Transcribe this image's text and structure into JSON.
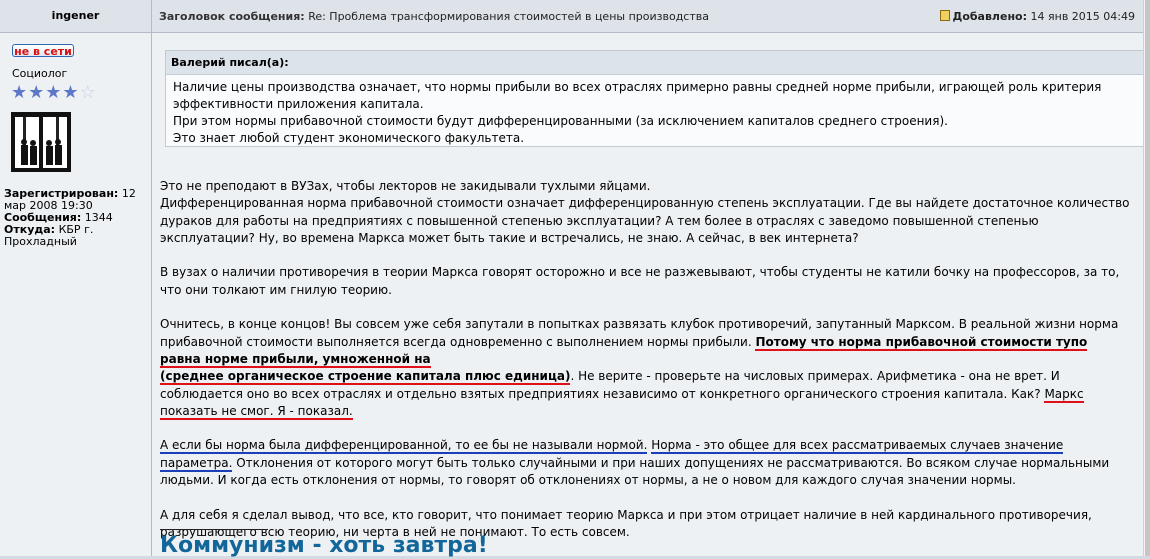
{
  "post": {
    "author": "ingener",
    "subject_label": "Заголовок сообщения:",
    "subject_text": "Re: Проблема трансформирования стоимостей в цены производства",
    "posted_label": "Добавлено:",
    "posted_date": "14 янв 2015 04:49"
  },
  "profile": {
    "status_button": "не в сети",
    "rank": "Социолог",
    "stars_filled": 4,
    "stars_total": 5,
    "registered_label": "Зарегистрирован:",
    "registered_value": "12 мар 2008 19:30",
    "posts_label": "Сообщения:",
    "posts_value": "1344",
    "location_label": "Откуда:",
    "location_value": "КБР г. Прохладный"
  },
  "quote": {
    "header": "Валерий писал(а):",
    "lines": [
      "Наличие цены производства означает, что нормы прибыли во всех отраслях примерно равны средней норме прибыли, играющей роль критерия эффективности приложения капитала.",
      "При этом нормы прибавочной стоимости будут дифференцированными (за исключением капиталов среднего строения).",
      "Это знает любой студент экономического факультета."
    ]
  },
  "body": {
    "p1_line1": "Это не преподают в ВУЗах, чтобы лекторов не закидывали тухлыми яйцами.",
    "p1_rest": "Дифференцированная норма прибавочной стоимости означает дифференцированную степень эксплуатации. Где вы найдете достаточное количество дураков для работы на предприятиях с повышенной степенью эксплуатации? А тем более в отраслях с заведомо повышенной степенью эксплуатации? Ну, во времена Маркса может быть такие и встречались, не знаю. А сейчас, в век интернета?",
    "p2": "В вузах о наличии противоречия в теории Маркса говорят осторожно и все не разжевывают, чтобы студенты не катили бочку на профессоров, за то, что они толкают им гнилую теорию.",
    "p3_a": "Очнитесь, в конце концов! Вы совсем уже себя запутали в попытках развязать клубок противоречий, запутанный Марксом. В реальной жизни норма прибавочной стоимости выполняется всегда одновременно с выполнением нормы прибыли. ",
    "p3_bold1": "Потому что норма прибавочной стоимости тупо равна норме прибыли, умноженной на",
    "p3_bold2": "(среднее органическое строение капитала плюс единица)",
    "p3_b": ". Не верите - проверьте на числовых примерах. Арифметика - она не врет. И соблюдается оно во всех отраслях и отдельно взятых предприятиях независимо от конкретного органического строения капитала. Как? ",
    "p3_ul": "Маркс показать не смог. Я - показал.",
    "p4_ul1": "А если бы норма была дифференцированной, то ее бы не называли нормой.",
    "p4_sp": " ",
    "p4_ul2": "Норма - это общее для всех рассматриваемых случаев значение параметра.",
    "p4_rest": " Отклонения от которого могут быть только случайными и при наших допущениях не рассматриваются. Во всяком случае нормальными людьми. И когда есть отклонения от нормы, то говорят об отклонениях от нормы, а не о новом для каждого случая значении нормы.",
    "p5": "А для себя я сделал вывод, что все, кто говорит, что понимает теорию Маркса и при этом отрицает наличие в ней кардинального противоречия, разрушающего всю теорию, ни черта в ней не понимают. То есть совсем."
  },
  "signature": "Коммунизм - хоть завтра!",
  "icons": {
    "posted": "document-icon",
    "avatar": "avatar-image",
    "star": "star-icon"
  }
}
